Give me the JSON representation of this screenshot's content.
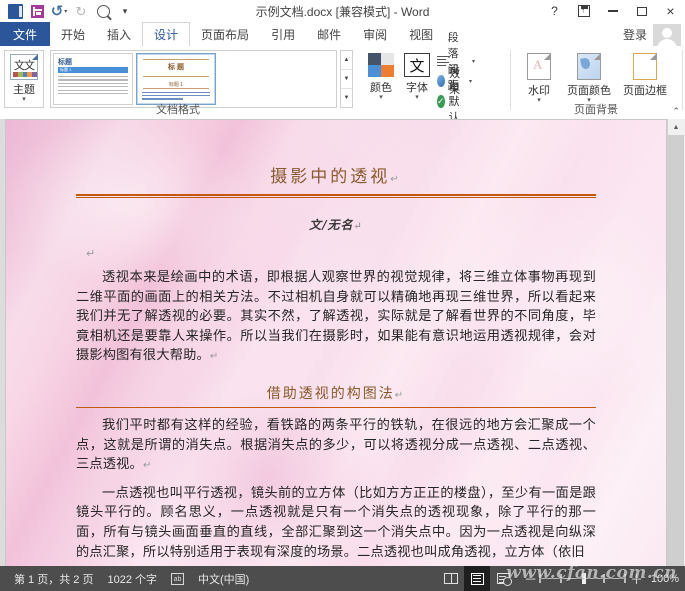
{
  "window": {
    "title": "示例文档.docx [兼容模式] - Word",
    "quick_access": [
      {
        "name": "word-logo",
        "label": "W"
      },
      {
        "name": "save",
        "label": "保存"
      },
      {
        "name": "undo",
        "label": "撤消"
      },
      {
        "name": "redo",
        "label": "恢复"
      },
      {
        "name": "print-preview",
        "label": "打印预览和打印"
      },
      {
        "name": "customize",
        "label": "自定义快速访问工具栏"
      }
    ],
    "controls": {
      "help": "?",
      "ribbon_display": "功能区显示选项",
      "minimize": "最小化",
      "maximize": "最大化",
      "close": "×"
    },
    "signin": "登录"
  },
  "tabs": [
    {
      "label": "文件",
      "active": false,
      "file": true
    },
    {
      "label": "开始",
      "active": false
    },
    {
      "label": "插入",
      "active": false
    },
    {
      "label": "设计",
      "active": true
    },
    {
      "label": "页面布局",
      "active": false
    },
    {
      "label": "引用",
      "active": false
    },
    {
      "label": "邮件",
      "active": false
    },
    {
      "label": "审阅",
      "active": false
    },
    {
      "label": "视图",
      "active": false
    }
  ],
  "ribbon": {
    "groups": [
      {
        "name": "document-format",
        "label": "文档格式"
      },
      {
        "name": "page-background",
        "label": "页面背景"
      }
    ],
    "theme_button": {
      "label": "主题",
      "thumb_text": "文文"
    },
    "gallery": {
      "thumbs": [
        {
          "name": "style-set-1",
          "title": "标题",
          "sub": "标题 1",
          "selected": false
        },
        {
          "name": "style-set-2",
          "title": "标 题",
          "sub": "标题 1",
          "selected": true
        }
      ],
      "scroll_up": "▲",
      "scroll_down": "▼",
      "scroll_more": "▼"
    },
    "colors_button": {
      "label": "颜色"
    },
    "fonts_button": {
      "label": "字体",
      "glyph": "文"
    },
    "small_commands": [
      {
        "name": "paragraph-spacing",
        "label": "段落间距",
        "has_caret": true
      },
      {
        "name": "effects",
        "label": "效果",
        "has_caret": true
      },
      {
        "name": "set-as-default",
        "label": "设为默认值",
        "has_caret": false
      }
    ],
    "page_background": [
      {
        "name": "watermark",
        "label": "水印",
        "has_caret": true
      },
      {
        "name": "page-color",
        "label": "页面颜色",
        "has_caret": true
      },
      {
        "name": "page-borders",
        "label": "页面边框",
        "has_caret": false
      }
    ],
    "collapse": "⌃"
  },
  "document": {
    "title": "摄影中的透视",
    "byline": "文/无名",
    "blank_line": "↵",
    "pilcrow": "↵",
    "paragraph1": "透视本来是绘画中的术语，即根据人观察世界的视觉规律，将三维立体事物再现到二维平面的画面上的相关方法。不过相机自身就可以精确地再现三维世界，所以看起来我们并无了解透视的必要。其实不然，了解透视，实际就是了解看世界的不同角度，毕竟相机还是要靠人来操作。所以当我们在摄影时，如果能有意识地运用透视规律，会对摄影构图有很大帮助。",
    "heading2": "借助透视的构图法",
    "paragraph2": "我们平时都有这样的经验，看铁路的两条平行的铁轨，在很远的地方会汇聚成一个点，这就是所谓的消失点。根据消失点的多少，可以将透视分成一点透视、二点透视、三点透视。",
    "paragraph3": "一点透视也叫平行透视，镜头前的立方体（比如方方正正的楼盘），至少有一面是跟镜头平行的。顾名思义，一点透视就是只有一个消失点的透视现象，除了平行的那一面，所有与镜头画面垂直的直线，全部汇聚到这一个消失点中。因为一点透视是向纵深的点汇聚，所以特别适用于表现有深度的场景。二点透视也叫成角透视，立方体（依旧"
  },
  "status_bar": {
    "page_info": "第 1 页，共 2 页",
    "word_count": "1022 个字",
    "proofing_icon": "校对",
    "language": "中文(中国)",
    "views": [
      {
        "name": "read-mode",
        "label": "阅读视图",
        "active": false
      },
      {
        "name": "print-layout",
        "label": "页面视图",
        "active": true
      },
      {
        "name": "web-layout",
        "label": "Web 版式视图",
        "active": false
      }
    ],
    "zoom": {
      "minus": "－",
      "plus": "＋",
      "percent": "100%",
      "value": 100
    }
  },
  "watermark_text": "www.cfan.com.cn",
  "colors": {
    "accent_blue": "#2b579a",
    "title_brown": "#8a5a2b",
    "rule_orange": "#c45911",
    "page_pink": "#f9dcea",
    "status_gray": "#4d4d4d"
  }
}
